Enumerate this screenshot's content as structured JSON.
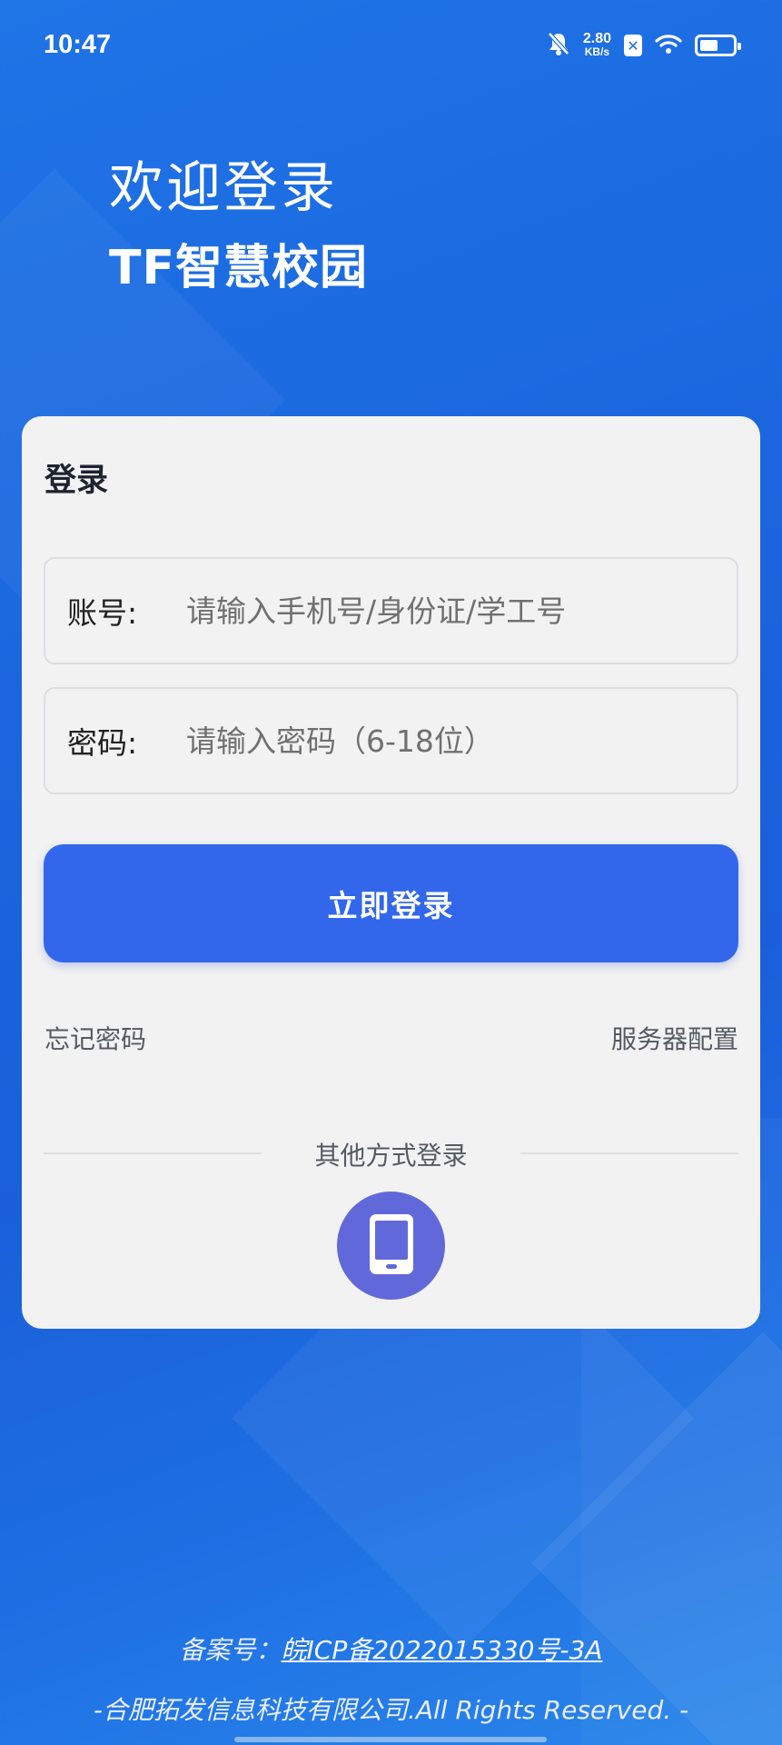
{
  "status_bar": {
    "time": "10:47",
    "net_speed_value": "2.80",
    "net_speed_unit": "KB/s",
    "sim_badge": "✕",
    "battery_level": 0.55,
    "icons": [
      "mute-bell-icon",
      "sim-x-icon",
      "wifi-icon",
      "battery-icon"
    ]
  },
  "header": {
    "welcome": "欢迎登录",
    "app_name": "TF智慧校园"
  },
  "card": {
    "title": "登录",
    "account_label": "账号:",
    "account_placeholder": "请输入手机号/身份证/学工号",
    "password_label": "密码:",
    "password_placeholder": "请输入密码（6-18位）",
    "login_button": "立即登录",
    "forgot_password": "忘记密码",
    "server_config": "服务器配置",
    "other_login": "其他方式登录",
    "phone_login_icon": "mobile-phone-icon"
  },
  "footer": {
    "icp_prefix": "备案号：",
    "icp_number": "皖ICP备2022015330号-3A",
    "copyright": "-合肥拓发信息科技有限公司.All Rights Reserved. -"
  },
  "colors": {
    "background_blue": "#1f6fe3",
    "primary_button": "#3267ec",
    "phone_circle": "#6169da",
    "card_bg": "#f2f2f3"
  }
}
